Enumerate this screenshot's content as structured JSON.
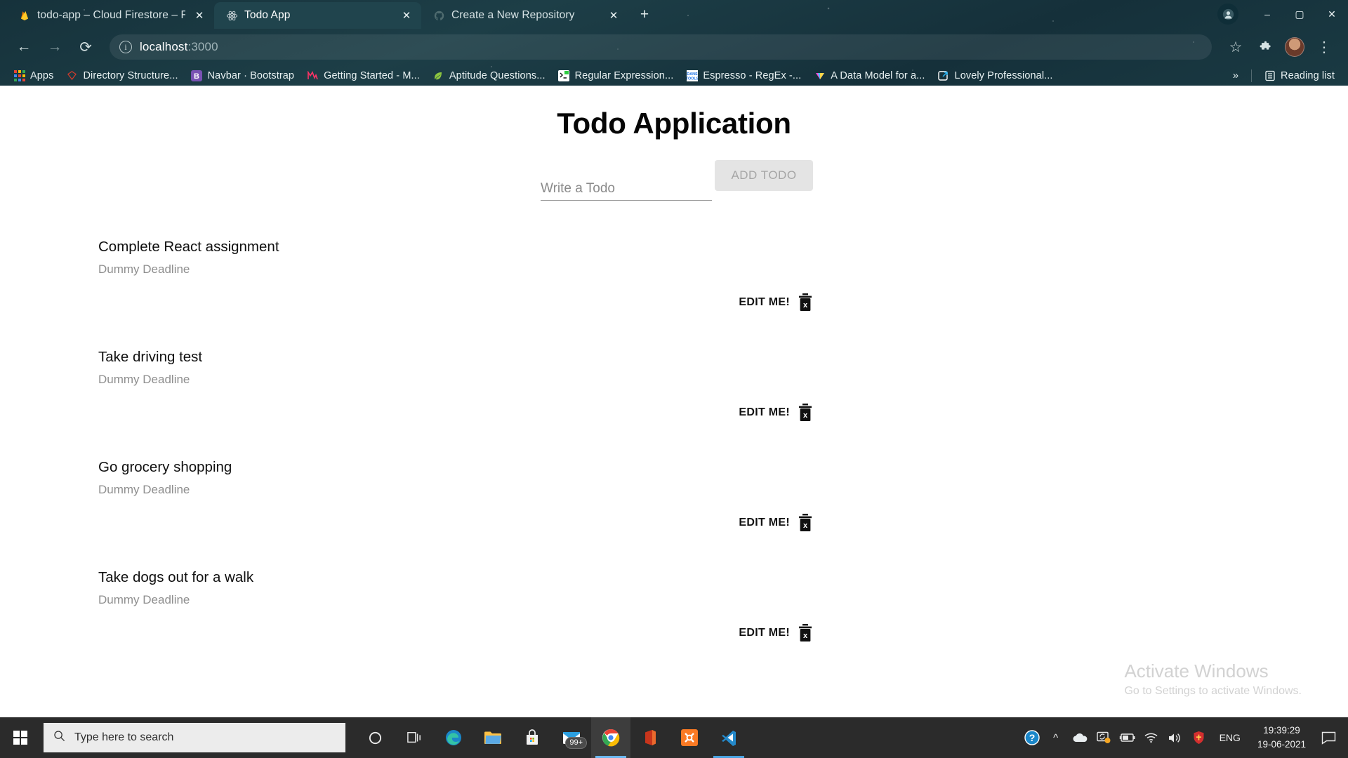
{
  "browser": {
    "tabs": [
      {
        "title": "todo-app – Cloud Firestore – Fire",
        "favicon": "firebase-icon",
        "active": false
      },
      {
        "title": "Todo App",
        "favicon": "react-icon",
        "active": true
      },
      {
        "title": "Create a New Repository",
        "favicon": "github-icon",
        "active": false
      }
    ],
    "new_tab_label": "+",
    "window_controls": {
      "minimize": "–",
      "maximize": "▢",
      "close": "✕"
    },
    "nav": {
      "back": "←",
      "forward": "→",
      "reload": "⟳",
      "info_icon": "i",
      "url_host": "localhost",
      "url_port": ":3000",
      "star": "☆",
      "extensions": "puzzle-icon",
      "menu": "⋮"
    },
    "bookmarks": {
      "apps_label": "Apps",
      "items": [
        {
          "label": "Directory Structure...",
          "icon": "ruby-icon"
        },
        {
          "label": "Navbar · Bootstrap",
          "icon": "bootstrap-icon"
        },
        {
          "label": "Getting Started - M...",
          "icon": "material-icon"
        },
        {
          "label": "Aptitude Questions...",
          "icon": "leaf-icon"
        },
        {
          "label": "Regular Expression...",
          "icon": "terminal-icon"
        },
        {
          "label": "Espresso - RegEx -...",
          "icon": "dans-tools-icon"
        },
        {
          "label": "A Data Model for a...",
          "icon": "prism-icon"
        },
        {
          "label": "Lovely Professional...",
          "icon": "link-square-icon"
        }
      ],
      "overflow_label": "»",
      "reading_list_label": "Reading list",
      "reading_list_icon": "reading-list-icon"
    }
  },
  "app": {
    "title": "Todo Application",
    "input_placeholder": "Write a Todo",
    "input_value": "",
    "add_button_label": "ADD TODO",
    "edit_label": "EDIT ME!",
    "delete_icon": "trash-icon",
    "todos": [
      {
        "title": "Complete React assignment",
        "deadline": "Dummy Deadline"
      },
      {
        "title": "Take driving test",
        "deadline": "Dummy Deadline"
      },
      {
        "title": "Go grocery shopping",
        "deadline": "Dummy Deadline"
      },
      {
        "title": "Take dogs out for a walk",
        "deadline": "Dummy Deadline"
      }
    ]
  },
  "watermark": {
    "line1": "Activate Windows",
    "line2": "Go to Settings to activate Windows."
  },
  "taskbar": {
    "start_icon": "windows-logo-icon",
    "search_placeholder": "Type here to search",
    "search_icon": "search-icon",
    "icons": [
      {
        "name": "cortana-icon",
        "badge": ""
      },
      {
        "name": "task-view-icon",
        "badge": ""
      },
      {
        "name": "edge-icon",
        "badge": ""
      },
      {
        "name": "file-explorer-icon",
        "badge": ""
      },
      {
        "name": "microsoft-store-icon",
        "badge": ""
      },
      {
        "name": "mail-icon",
        "badge": "99+"
      },
      {
        "name": "chrome-icon",
        "badge": ""
      },
      {
        "name": "office-icon",
        "badge": ""
      },
      {
        "name": "xampp-icon",
        "badge": ""
      },
      {
        "name": "vscode-icon",
        "badge": ""
      }
    ],
    "tray": {
      "help_icon": "help-icon",
      "chevron_icon": "show-hidden-icons-chevron",
      "onedrive_icon": "onedrive-icon",
      "update_icon": "windows-update-icon",
      "battery_icon": "battery-icon",
      "wifi_icon": "wifi-icon",
      "volume_icon": "volume-icon",
      "security_icon": "security-shield-icon",
      "language": "ENG",
      "time": "19:39:29",
      "date": "19-06-2021",
      "notifications_icon": "action-center-icon"
    }
  },
  "colors": {
    "chrome_bg": "#1e3840",
    "active_tab": "#20444d",
    "page_bg": "#ffffff",
    "taskbar": "#2b2b2b",
    "accent_blue": "#4aa3e0",
    "muted_text": "#8e8e8e"
  }
}
